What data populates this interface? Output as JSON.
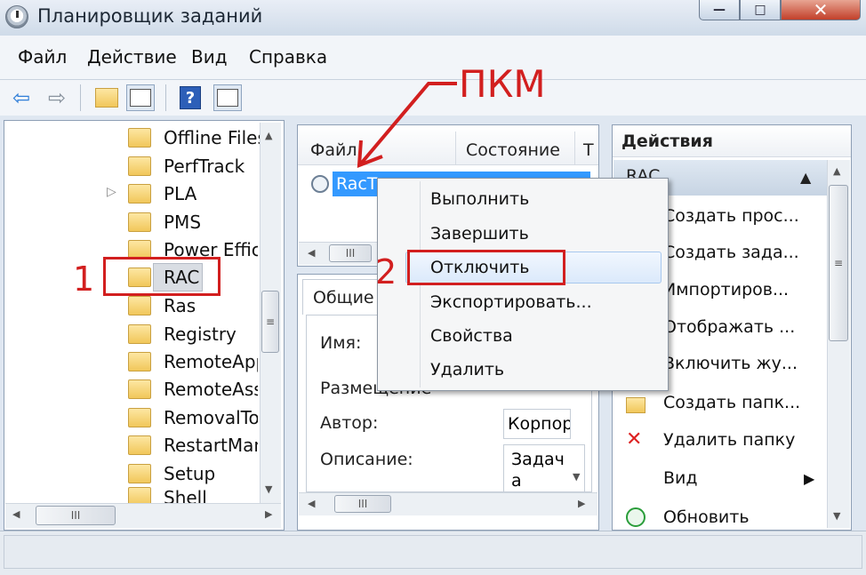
{
  "window": {
    "title": "Планировщик заданий",
    "close_glyph": "✕",
    "maximize_glyph": "□",
    "minimize_glyph": "—"
  },
  "menu": [
    "Файл",
    "Действие",
    "Вид",
    "Справка"
  ],
  "toolbar": {
    "icons": [
      "back-arrow-icon",
      "forward-arrow-icon",
      "up-folder-icon",
      "console-tree-icon",
      "help-icon",
      "action-pane-icon"
    ]
  },
  "tree": {
    "items": [
      "Offline Files",
      "PerfTrack",
      "PLA",
      "PMS",
      "Power Effici",
      "RAC",
      "Ras",
      "Registry",
      "RemoteApp",
      "RemoteAssi",
      "RemovalTo",
      "RestartMan",
      "Setup",
      "Shell"
    ],
    "selected": "RAC",
    "expander_glyph": "▷"
  },
  "task_list": {
    "columns": [
      "Файл",
      "Состояние",
      "Т"
    ],
    "row": "RacT"
  },
  "details": {
    "tab": "Общие",
    "fields": [
      {
        "label": "Имя:",
        "value": ""
      },
      {
        "label": "Размещение:",
        "value": ""
      },
      {
        "label": "Автор:",
        "value": "Корпор"
      },
      {
        "label": "Описание:",
        "value": "Задача данны"
      }
    ]
  },
  "context_menu": {
    "items": [
      "Выполнить",
      "Завершить",
      "Отключить",
      "Экспортировать...",
      "Свойства",
      "Удалить"
    ]
  },
  "actions": {
    "header": "Действия",
    "group": "RAC",
    "items": [
      "Создать прос...",
      "Создать зада...",
      "Импортиров...",
      "Отображать ...",
      "Включить жу...",
      "Создать папк...",
      "Удалить папку",
      "Вид",
      "Обновить"
    ]
  },
  "annotations": {
    "pkm": "ПКМ",
    "one": "1",
    "two": "2"
  },
  "colors": {
    "annotation_red": "#d21f1f",
    "selection_blue": "#3399ff"
  }
}
